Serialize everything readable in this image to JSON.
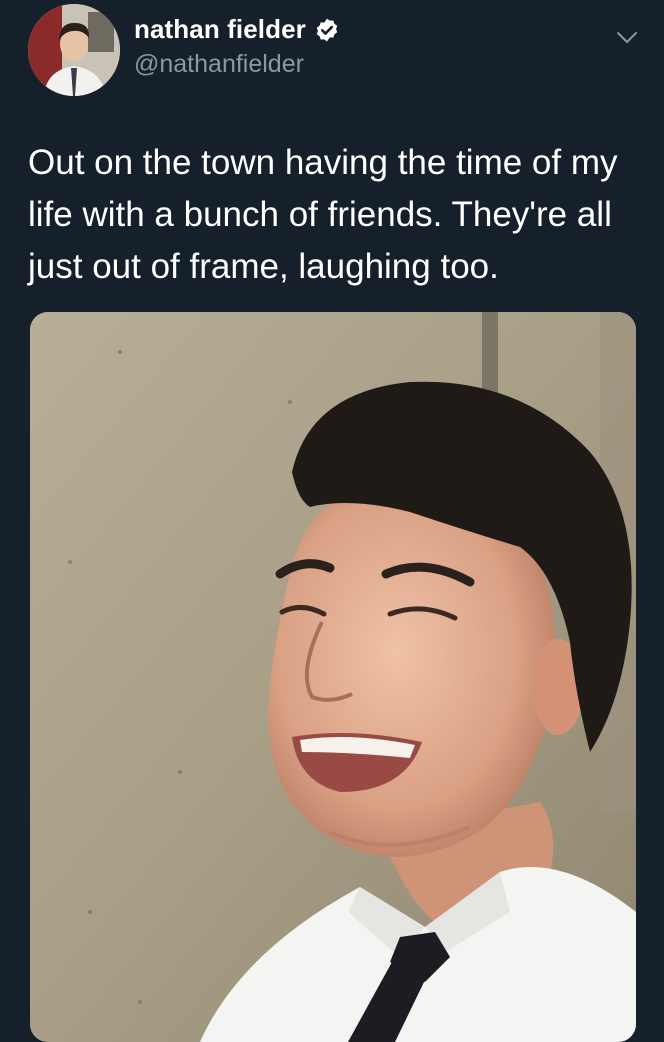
{
  "account": {
    "display_name": "nathan fielder",
    "handle": "@nathanfielder",
    "verified": true
  },
  "tweet": {
    "text": "Out on the town having the time of my life with a bunch of friends. They're all just out of frame, laughing too."
  },
  "icons": {
    "verified": "verified-badge-icon",
    "menu": "chevron-down-icon"
  },
  "colors": {
    "background": "#15202b",
    "handle": "#8899a6",
    "text": "#ffffff"
  }
}
